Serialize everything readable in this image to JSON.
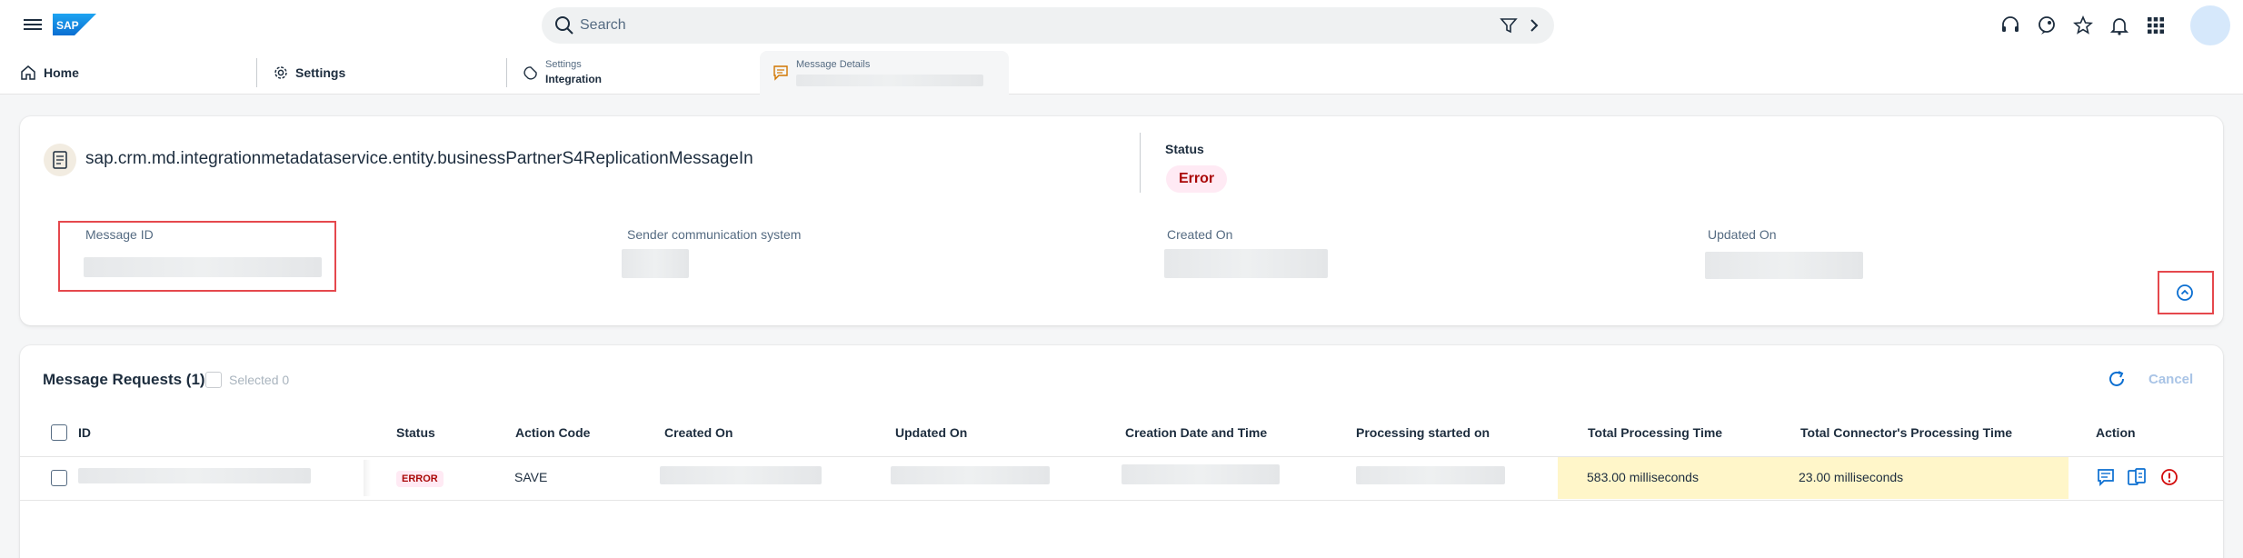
{
  "shell": {
    "search_placeholder": "Search",
    "icons": [
      "menu-icon",
      "sap-logo",
      "search-icon",
      "filter-icon",
      "chevron-right-icon",
      "headset-icon",
      "feedback-icon",
      "star-icon",
      "bell-icon",
      "grid-icon"
    ]
  },
  "tabs": [
    {
      "label": "Home",
      "icon": "home-icon"
    },
    {
      "label": "Settings",
      "icon": "gear-icon"
    },
    {
      "small": "Settings",
      "label": "Integration",
      "icon": "integration-icon"
    },
    {
      "small": "Message Details",
      "label": "",
      "icon": "message-icon"
    }
  ],
  "header": {
    "entity_name": "sap.crm.md.integrationmetadataservice.entity.businessPartnerS4ReplicationMessageIn",
    "status_label": "Status",
    "status_value": "Error",
    "fields": {
      "message_id": "Message ID",
      "sender_system": "Sender communication system",
      "created_on": "Created On",
      "updated_on": "Updated On"
    }
  },
  "requests": {
    "title": "Message Requests (1)",
    "selected_label": "Selected 0",
    "cancel_label": "Cancel",
    "columns": [
      "ID",
      "Status",
      "Action Code",
      "Created On",
      "Updated On",
      "Creation Date and Time",
      "Processing started on",
      "Total Processing Time",
      "Total Connector's Processing Time",
      "Action"
    ],
    "rows": [
      {
        "status": "ERROR",
        "action_code": "SAVE",
        "total_processing_time": "583.00 milliseconds",
        "total_connector_time": "23.00 milliseconds"
      }
    ]
  },
  "colors": {
    "error_text": "#aa0808",
    "error_bg": "#ffeaf4",
    "accent_blue": "#0a6ed1",
    "highlight": "#fff6c9",
    "annotation_red": "#e5484d"
  }
}
